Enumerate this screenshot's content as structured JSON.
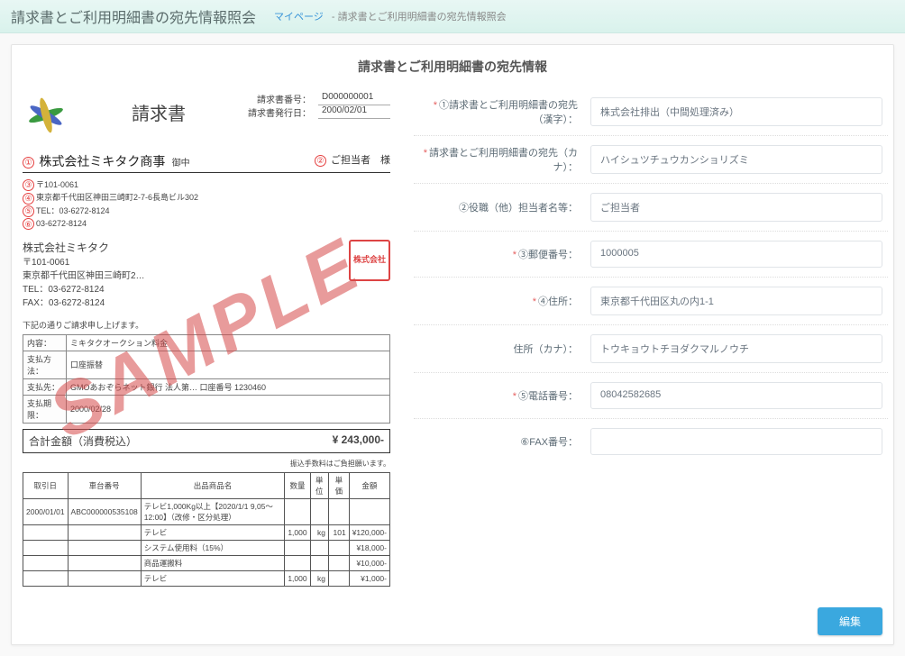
{
  "header": {
    "page_title": "請求書とご利用明細書の宛先情報照会",
    "breadcrumb_link": "マイページ",
    "breadcrumb_sep": " - ",
    "breadcrumb_current": "請求書とご利用明細書の宛先情報照会"
  },
  "section_title": "請求書とご利用明細書の宛先情報",
  "sample_watermark": "SAMPLE",
  "invoice_sample": {
    "title": "請求書",
    "meta": {
      "number_label": "請求書番号：",
      "number_value": "D000000001",
      "date_label": "請求書発行日：",
      "date_value": "2000/02/01"
    },
    "markers": {
      "m1": "①",
      "m2": "②",
      "m3": "③",
      "m4": "④",
      "m5": "⑤",
      "m6": "⑥"
    },
    "company_name": "株式会社ミキタク商事",
    "onchu": "御中",
    "tantou_label": "ご担当者",
    "tantou_suffix": "様",
    "addr": {
      "postal": "〒101-0061",
      "line1": "東京都千代田区神田三崎町2-7-6長島ビル302",
      "tel_label": "TEL：",
      "tel": "03-6272-8124",
      "fax": "03-6272-8124"
    },
    "sender": {
      "company": "株式会社ミキタク",
      "postal": "〒101-0061",
      "address": "東京都千代田区神田三崎町2…",
      "tel_label": "TEL：",
      "tel": "03-6272-8124",
      "fax_label": "FAX：",
      "fax": "03-6272-8124"
    },
    "stamp_text": "株式会社",
    "note": "下記の通りご請求申し上げます。",
    "summary": {
      "rows": [
        {
          "label": "内容：",
          "value": "ミキタクオークション料金"
        },
        {
          "label": "支払方法：",
          "value": "口座振替"
        },
        {
          "label": "支払先：",
          "value": "GMOあおぞらネット銀行 法人第… 口座番号 1230460"
        },
        {
          "label": "支払期限：",
          "value": "2000/02/28"
        }
      ]
    },
    "total_label": "合計金額（消費税込）",
    "total_value": "¥ 243,000-",
    "sub_note": "振込手数料はご負担願います。",
    "items": {
      "headers": [
        "取引日",
        "車台番号",
        "出品商品名",
        "数量",
        "単位",
        "単価",
        "金額"
      ],
      "data_rows": [
        [
          "2000/01/01",
          "ABC000000535108",
          "テレビ1,000Kg以上【2020/1/1 9,05～12:00】（改修・区分処理）",
          "",
          "",
          "",
          ""
        ],
        [
          "",
          "",
          "テレビ",
          "1,000",
          "kg",
          "101",
          "¥120,000-"
        ],
        [
          "",
          "",
          "システム使用料（15%）",
          "",
          "",
          "",
          "¥18,000-"
        ],
        [
          "",
          "",
          "商品運搬料",
          "",
          "",
          "",
          "¥10,000-"
        ],
        [
          "",
          "",
          "テレビ",
          "1,000",
          "kg",
          "",
          "¥1,000-"
        ]
      ]
    }
  },
  "form": {
    "rows": [
      {
        "required": true,
        "label": "①請求書とご利用明細書の宛先（漢字）：",
        "value": "株式会社排出（中間処理済み）"
      },
      {
        "required": true,
        "label": "請求書とご利用明細書の宛先（カナ）：",
        "value": "ハイシュツチュウカンショリズミ"
      },
      {
        "required": false,
        "label": "②役職（他）担当者名等：",
        "value": "ご担当者"
      },
      {
        "required": true,
        "label": "③郵便番号：",
        "value": "1000005"
      },
      {
        "required": true,
        "label": "④住所：",
        "value": "東京都千代田区丸の内1-1"
      },
      {
        "required": false,
        "label": "住所（カナ）：",
        "value": "トウキョウトチヨダクマルノウチ"
      },
      {
        "required": true,
        "label": "⑤電話番号：",
        "value": "08042582685"
      },
      {
        "required": false,
        "label": "⑥FAX番号：",
        "value": ""
      }
    ],
    "edit_button": "編集"
  },
  "required_mark": "*"
}
